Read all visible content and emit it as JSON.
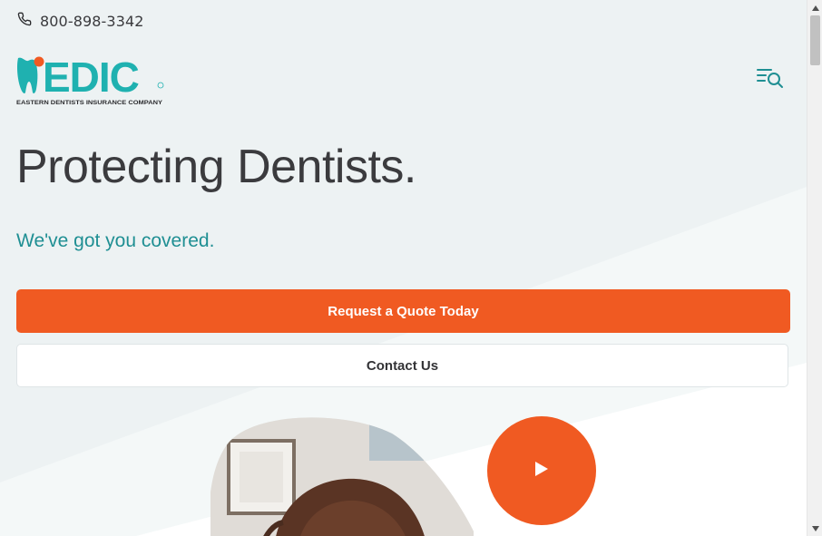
{
  "header": {
    "phone_icon": "phone-icon",
    "phone_number": "800-898-3342",
    "logo_text": "EDIC",
    "logo_tagline": "EASTERN DENTISTS INSURANCE COMPANY",
    "menu_icon": "menu-search-icon"
  },
  "hero": {
    "title": "Protecting Dentists.",
    "subtitle": "We've got you covered.",
    "quote_button": "Request a Quote Today",
    "contact_button": "Contact Us"
  },
  "media": {
    "play_icon": "play-icon"
  },
  "colors": {
    "accent": "#f05a22",
    "brand_teal": "#1fb1b0",
    "subtitle_teal": "#1f8f93",
    "background": "#edf2f3"
  }
}
